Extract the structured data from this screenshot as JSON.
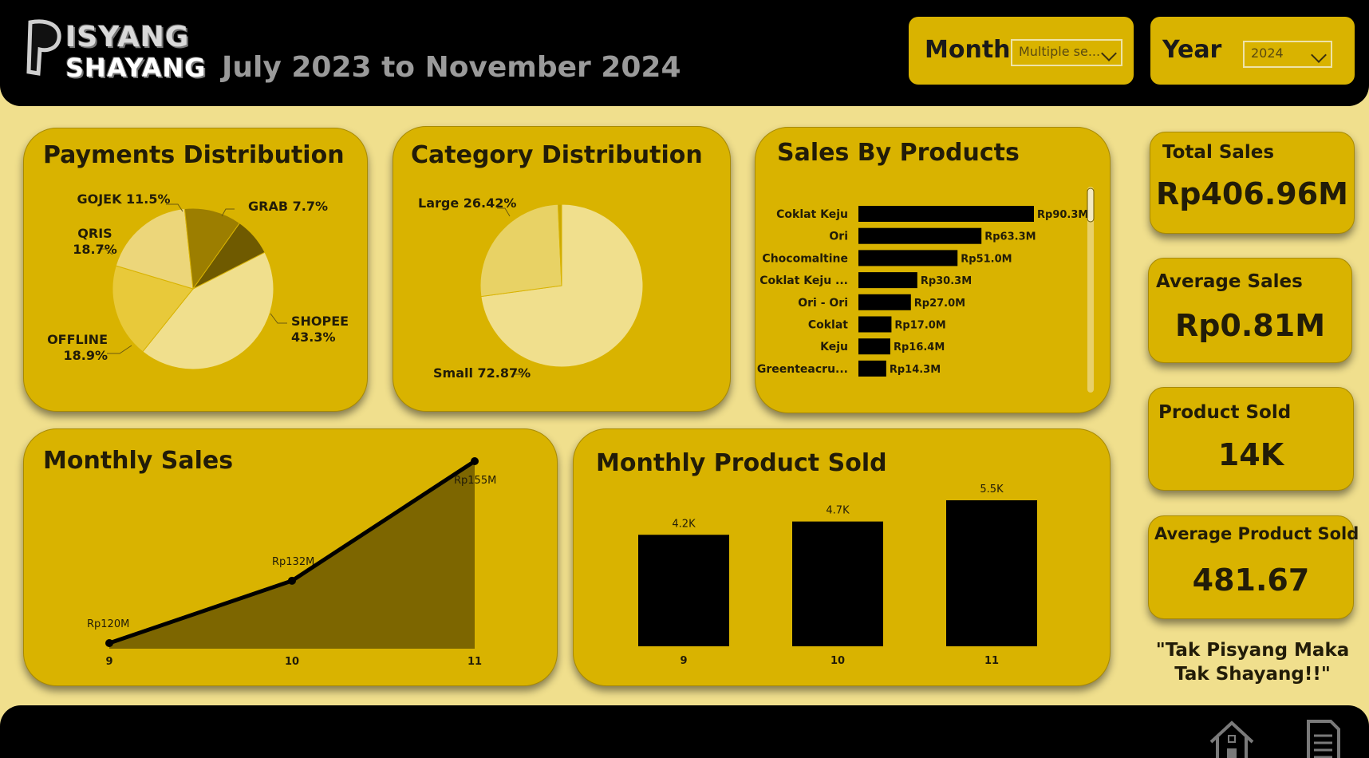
{
  "header": {
    "logo_line1": "ISYANG",
    "logo_line2": "SHAYANG",
    "period": "July 2023 to November 2024"
  },
  "filters": {
    "month_label": "Month",
    "month_value": "Multiple se...",
    "year_label": "Year",
    "year_value": "2024"
  },
  "cards": {
    "payments_title": "Payments Distribution",
    "category_title": "Category Distribution",
    "products_title": "Sales By Products",
    "monthly_sales_title": "Monthly Sales",
    "monthly_sold_title": "Monthly Product Sold"
  },
  "kpis": [
    {
      "label": "Total Sales",
      "value": "Rp406.96M"
    },
    {
      "label": "Average Sales",
      "value": "Rp0.81M"
    },
    {
      "label": "Product Sold",
      "value": "14K"
    },
    {
      "label": "Average Product Sold",
      "value": "481.67"
    }
  ],
  "quote": "\"Tak Pisyang Maka Tak Shayang!!\"",
  "colors": {
    "accent": "#d9b300",
    "background": "#f0df8d",
    "bars": "#000000",
    "area": "#7d6600"
  },
  "chart_data": [
    {
      "type": "pie",
      "title": "Payments Distribution",
      "categories": [
        "SHOPEE",
        "OFFLINE",
        "QRIS",
        "GOJEK",
        "GRAB"
      ],
      "values": [
        43.3,
        18.9,
        18.7,
        11.5,
        7.7
      ],
      "labels": [
        "SHOPEE 43.3%",
        "OFFLINE 18.9%",
        "QRIS 18.7%",
        "GOJEK 11.5%",
        "GRAB 7.7%"
      ],
      "colors": [
        "#f0df8d",
        "#e8c93a",
        "#ecd67a",
        "#9c7e00",
        "#6f5a00"
      ]
    },
    {
      "type": "pie",
      "title": "Category Distribution",
      "categories": [
        "Small",
        "Large"
      ],
      "values": [
        72.87,
        26.42,
        0.71
      ],
      "labels": [
        "Small 72.87%",
        "Large 26.42%"
      ],
      "colors": [
        "#f0df8d",
        "#e8d265",
        "#c9a800"
      ]
    },
    {
      "type": "bar",
      "orientation": "horizontal",
      "title": "Sales By Products",
      "categories": [
        "Coklat Keju",
        "Ori",
        "Chocomaltine",
        "Coklat Keju ...",
        "Ori - Ori",
        "Coklat",
        "Keju",
        "Greenteacru..."
      ],
      "values": [
        90.3,
        63.3,
        51.0,
        30.3,
        27.0,
        17.0,
        16.4,
        14.3
      ],
      "value_labels": [
        "Rp90.3M",
        "Rp63.3M",
        "Rp51.0M",
        "Rp30.3M",
        "Rp27.0M",
        "Rp17.0M",
        "Rp16.4M",
        "Rp14.3M"
      ],
      "unit": "Rp M"
    },
    {
      "type": "area",
      "title": "Monthly Sales",
      "x": [
        "9",
        "10",
        "11"
      ],
      "values": [
        120,
        132,
        155
      ],
      "value_labels": [
        "Rp120M",
        "Rp132M",
        "Rp155M"
      ],
      "ylim": [
        120,
        155
      ]
    },
    {
      "type": "bar",
      "title": "Monthly Product Sold",
      "categories": [
        "9",
        "10",
        "11"
      ],
      "values": [
        4.2,
        4.7,
        5.5
      ],
      "value_labels": [
        "4.2K",
        "4.7K",
        "5.5K"
      ],
      "ylim": [
        0,
        5.5
      ]
    }
  ],
  "nav": {
    "home_icon": "home-icon",
    "report_icon": "document-icon"
  }
}
